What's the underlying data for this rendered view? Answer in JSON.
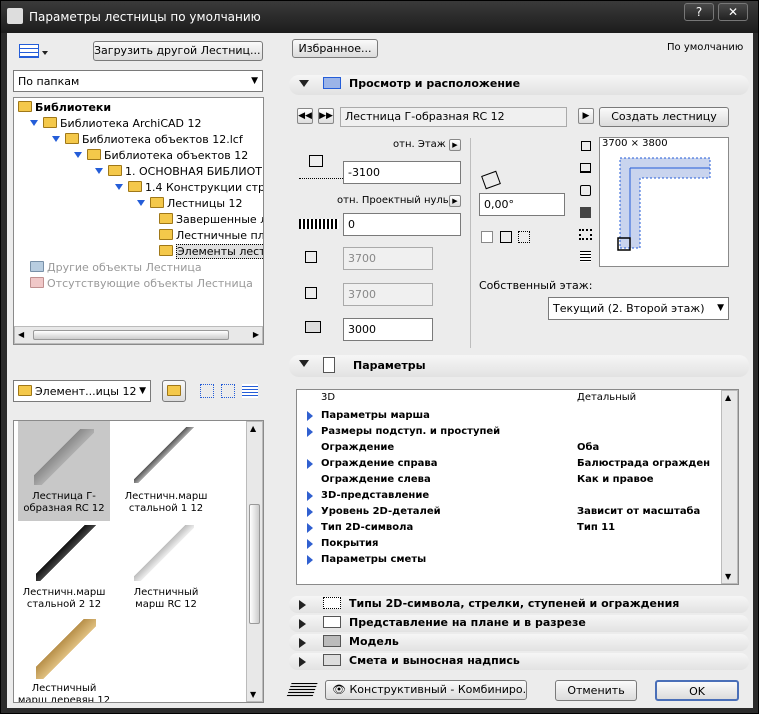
{
  "window": {
    "title": "Параметры лестницы по умолчанию",
    "help": "?",
    "close": "✕"
  },
  "left": {
    "load_button": "Загрузить другой Лестниц...",
    "view_select": "По папкам",
    "tree": [
      {
        "label": "Библиотеки",
        "bold": true
      },
      {
        "label": "Библиотека ArchiCAD 12"
      },
      {
        "label": "Библиотека объектов 12.lcf"
      },
      {
        "label": "Библиотека объектов 12"
      },
      {
        "label": "1. ОСНОВНАЯ БИБЛИОТЕКА"
      },
      {
        "label": "1.4 Конструкции строит"
      },
      {
        "label": "Лестницы 12"
      },
      {
        "label": "Завершенные л"
      },
      {
        "label": "Лестничные пл"
      },
      {
        "label": "Элементы лест"
      },
      {
        "label": "Другие объекты Лестница"
      },
      {
        "label": "Отсутствующие объекты Лестница"
      }
    ],
    "folder_select": "Элемент...ицы 12",
    "thumbs": [
      {
        "caption": "Лестница Г-образная RC 12"
      },
      {
        "caption": "Лестничн.марш стальной 1 12"
      },
      {
        "caption": "Лестничн.марш стальной 2 12"
      },
      {
        "caption": "Лестничный марш RC 12"
      },
      {
        "caption": "Лестничный марш деревян 12"
      }
    ]
  },
  "right": {
    "favorites_button": "Избранное...",
    "default_label": "По умолчанию",
    "section1": {
      "title": "Просмотр и расположение",
      "object_name": "Лестница Г-образная RC 12",
      "create_button": "Создать лестницу",
      "story_ref_label": "отн. Этаж",
      "story_ref_value": "-3100",
      "project_zero_label": "отн. Проектный нуль",
      "project_zero_value": "0",
      "width_value": "3700",
      "length_value": "3700",
      "height_value": "3000",
      "angle_value": "0,00°",
      "preview_size": "3700 × 3800",
      "home_story_label": "Собственный этаж:",
      "home_story_value": "Текущий (2. Второй этаж)"
    },
    "section2": {
      "title": "Параметры",
      "header_left": "3D",
      "header_right": "Детальный",
      "rows": [
        {
          "name": "Параметры марша",
          "value": ""
        },
        {
          "name": "Размеры подступ. и проступей",
          "value": ""
        },
        {
          "name": "Ограждение",
          "value": "Оба"
        },
        {
          "name": "Ограждение справа",
          "value": "Балюстрада огражден"
        },
        {
          "name": "Ограждение слева",
          "value": "Как и правое"
        },
        {
          "name": "3D-представление",
          "value": ""
        },
        {
          "name": "Уровень 2D-деталей",
          "value": "Зависит от масштаба"
        },
        {
          "name": "Тип 2D-символа",
          "value": "Тип 11"
        },
        {
          "name": "Покрытия",
          "value": ""
        },
        {
          "name": "Параметры сметы",
          "value": ""
        }
      ]
    },
    "collapsed_sections": [
      "Типы 2D-символа, стрелки, ступеней и ограждения",
      "Представление на плане и в разрезе",
      "Модель",
      "Смета и выносная надпись"
    ],
    "layer_select": "Конструктивный - Комбиниро...",
    "cancel_button": "Отменить",
    "ok_button": "OK"
  },
  "icons": [
    "app-icon",
    "list-view-icon",
    "folder-icon",
    "folder-up-icon",
    "stair-section-icon",
    "elevation-icon",
    "angle-icon",
    "preview-icon",
    "params-icon",
    "eye-icon",
    "layer-icon"
  ]
}
